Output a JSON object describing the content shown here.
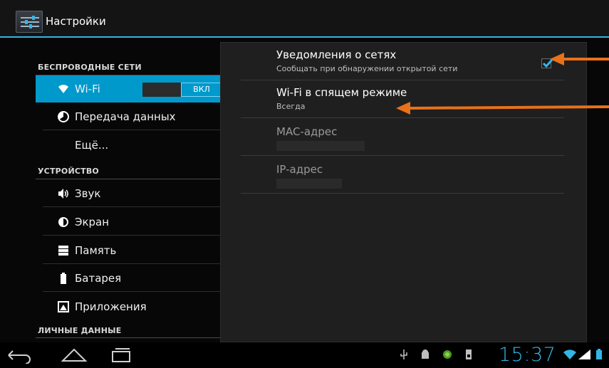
{
  "app": {
    "title": "Настройки"
  },
  "colors": {
    "accent": "#33b5e5",
    "selected": "#0099cc",
    "annotation": "#e8711a"
  },
  "sidebar": {
    "sections": [
      {
        "header": "БЕСПРОВОДНЫЕ СЕТИ"
      },
      {
        "header": "УСТРОЙСТВО"
      },
      {
        "header": "ЛИЧНЫЕ ДАННЫЕ"
      }
    ],
    "wifi": {
      "label": "Wi-Fi",
      "icon": "wifi-icon",
      "toggle_label": "ВКЛ",
      "toggle_on": true
    },
    "items": [
      {
        "label": "Передача данных",
        "icon": "data-usage-icon"
      },
      {
        "label": "Ещё..."
      },
      {
        "label": "Звук",
        "icon": "volume-icon"
      },
      {
        "label": "Экран",
        "icon": "brightness-icon"
      },
      {
        "label": "Память",
        "icon": "storage-icon"
      },
      {
        "label": "Батарея",
        "icon": "battery-icon"
      },
      {
        "label": "Приложения",
        "icon": "apps-icon"
      }
    ]
  },
  "wifi_advanced": {
    "items": [
      {
        "title": "Уведомления о сетях",
        "summary": "Сообщать при обнаружении открытой сети",
        "checked": true
      },
      {
        "title": "Wi-Fi в спящем режиме",
        "summary": "Всегда"
      },
      {
        "title": "MAC-адрес"
      },
      {
        "title": "IP-адрес"
      }
    ]
  },
  "status_bar": {
    "time": "15:37"
  }
}
